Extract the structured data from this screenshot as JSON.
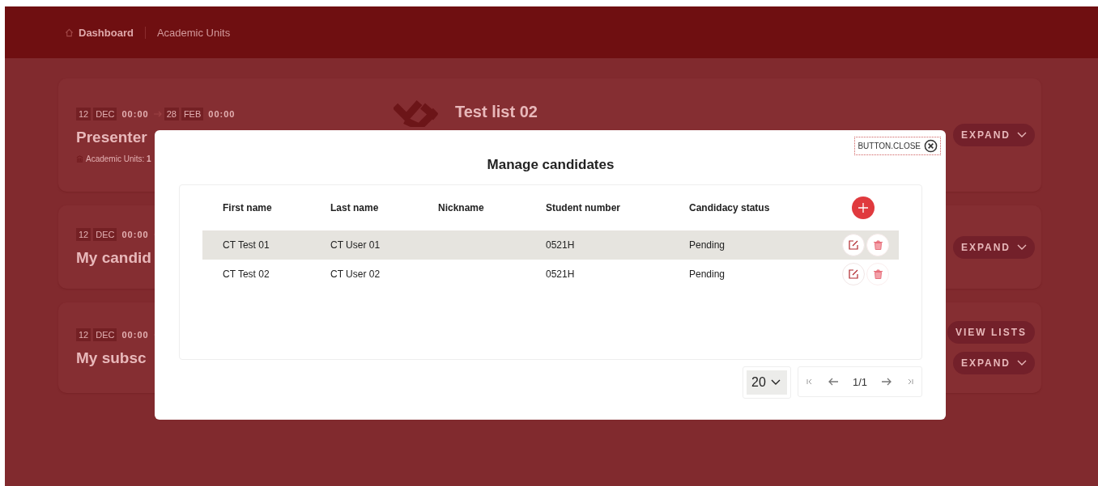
{
  "breadcrumbs": [
    {
      "label": "Dashboard",
      "kind": "home"
    },
    {
      "label": "Academic Units",
      "kind": "link"
    }
  ],
  "cards": [
    {
      "start": {
        "day": "12",
        "month": "DEC",
        "time": "00:00"
      },
      "end": {
        "day": "28",
        "month": "FEB",
        "time": "00:00"
      },
      "title": "Presenter",
      "meta": "Academic Units: **1**",
      "list_title": "Test list 02",
      "actions": [
        "EXPAND"
      ]
    },
    {
      "start": {
        "day": "12",
        "month": "DEC",
        "time": "00:00"
      },
      "title": "My candid",
      "actions": [
        "EXPAND"
      ]
    },
    {
      "start": {
        "day": "12",
        "month": "DEC",
        "time": "00:00"
      },
      "title": "My subsc",
      "actions": [
        "VIEW LISTS",
        "EXPAND"
      ]
    }
  ],
  "modal": {
    "close_label": "BUTTON.CLOSE",
    "title": "Manage candidates",
    "table": {
      "columns": [
        "First name",
        "Last name",
        "Nickname",
        "Student number",
        "Candidacy status"
      ],
      "rows": [
        {
          "cells": [
            "CT Test 01",
            "CT User 01",
            "",
            "0521H",
            "Pending"
          ],
          "highlighted": true
        },
        {
          "cells": [
            "CT Test 02",
            "CT User 02",
            "",
            "0521H",
            "Pending"
          ],
          "highlighted": false
        }
      ]
    },
    "page_size": "20",
    "page": "1/1"
  }
}
